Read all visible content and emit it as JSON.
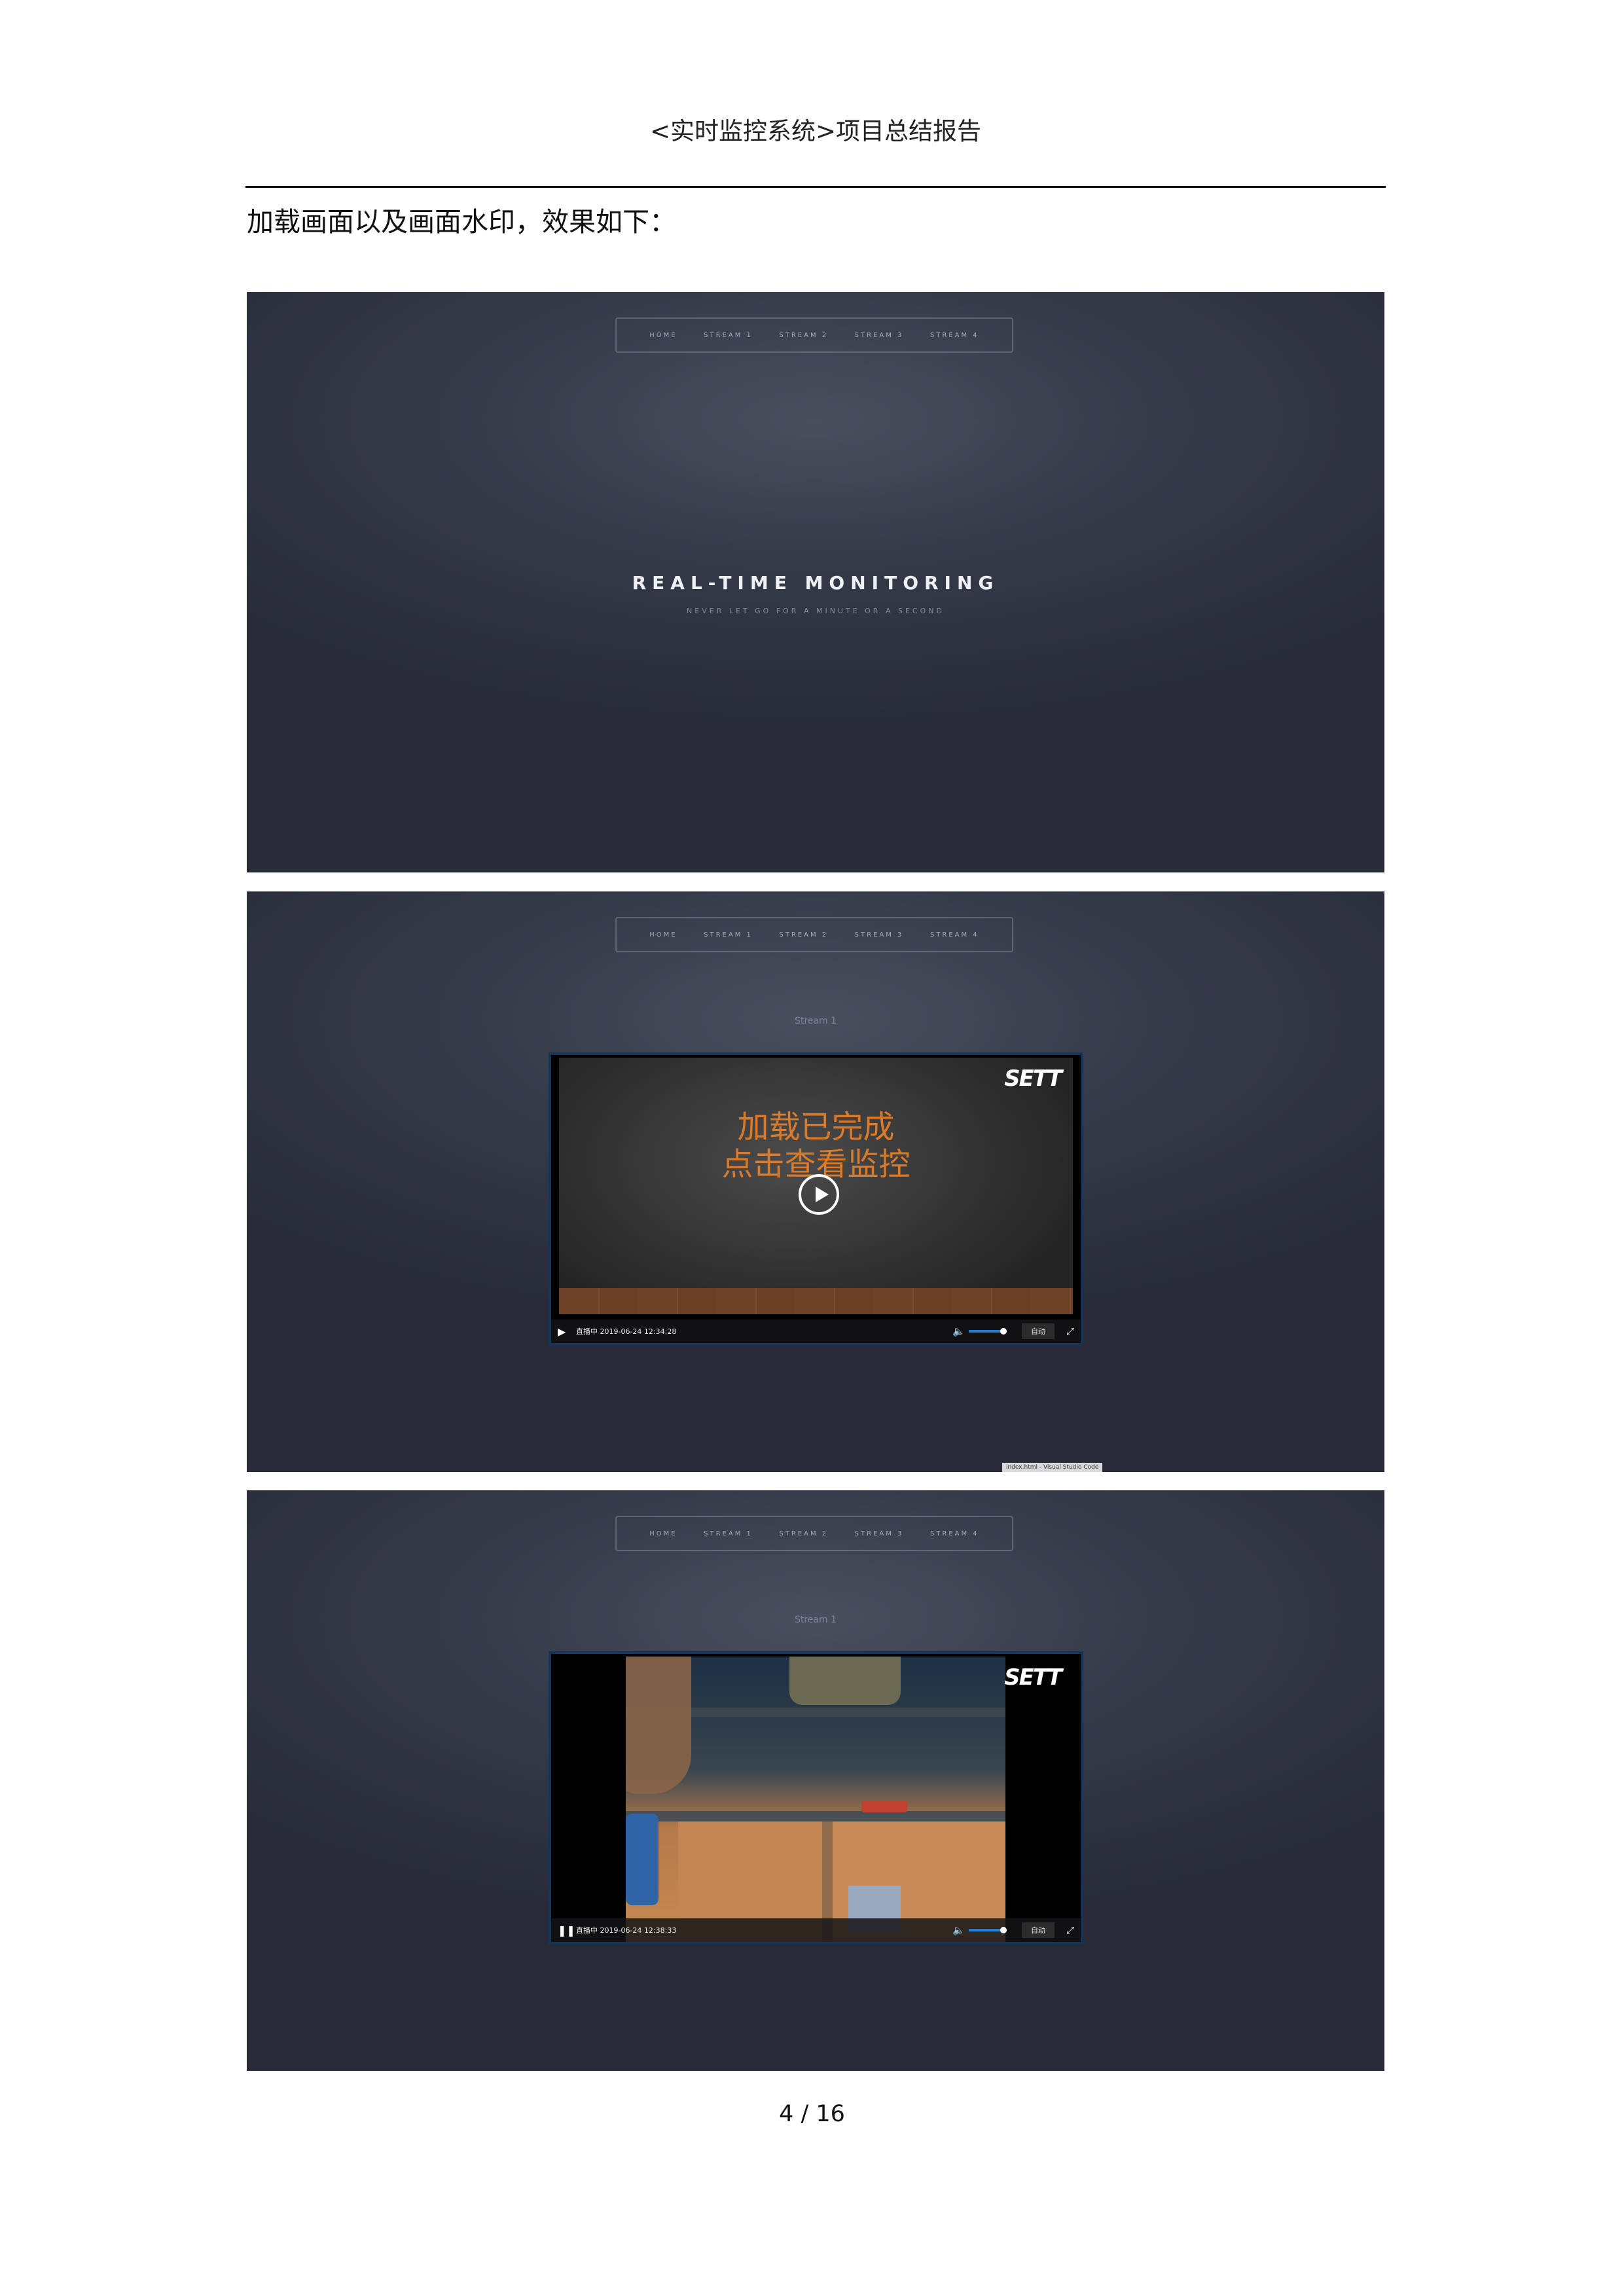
{
  "header": {
    "title": "<实时监控系统>项目总结报告"
  },
  "intro_text": "加载画面以及画面水印，效果如下：",
  "site": {
    "nav": [
      "HOME",
      "STREAM 1",
      "STREAM 2",
      "STREAM 3",
      "STREAM 4"
    ],
    "hero_title": "REAL-TIME MONITORING",
    "hero_subtitle": "NEVER LET GO FOR A MINUTE OR A SECOND",
    "stream_label": "Stream 1",
    "logo": "SETT"
  },
  "player_loading": {
    "overlay_line1": "加载已完成",
    "overlay_line2": "点击查看监控",
    "status": "直播中 2019-06-24 12:34:28",
    "quality": "自动"
  },
  "player_live": {
    "status": "直播中 2019-06-24 12:38:33",
    "quality": "自动"
  },
  "taskbar_tip": "index.html - Visual Studio Code",
  "icons": {
    "play": "play-icon",
    "pause": "pause-icon",
    "volume": "volume-icon",
    "fullscreen": "fullscreen-icon"
  },
  "colors": {
    "overlay_text": "#d97b2a",
    "player_border": "#183454",
    "volume_bar": "#1d7fd6"
  },
  "page": {
    "number": "4 / 16"
  }
}
